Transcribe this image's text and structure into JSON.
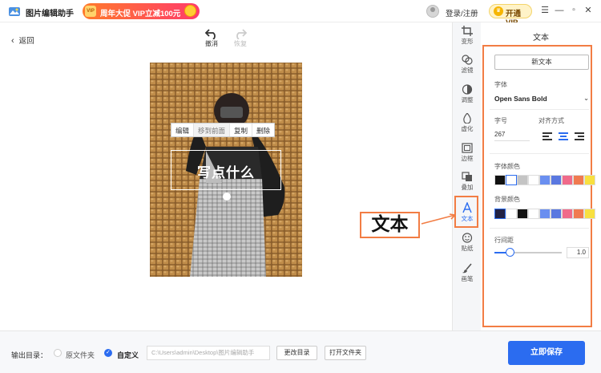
{
  "app": {
    "title": "图片编辑助手",
    "promo_badge": "VIP",
    "promo_text": "周年大促 VIP立减100元",
    "login": "登录/注册",
    "open_vip": "开通VIP",
    "window_controls": [
      "menu-icon",
      "minimize-icon",
      "restore-icon",
      "close-icon"
    ]
  },
  "toolbar": {
    "back": "返回",
    "undo": "撤消",
    "redo": "恢复"
  },
  "canvas": {
    "context_menu": [
      "编辑",
      "移到前面",
      "复制",
      "删除"
    ],
    "text_content": "写点什么"
  },
  "tools": [
    {
      "label": "变形",
      "icon": "crop-icon"
    },
    {
      "label": "滤镜",
      "icon": "filter-icon"
    },
    {
      "label": "调整",
      "icon": "adjust-icon"
    },
    {
      "label": "虚化",
      "icon": "blur-drop-icon"
    },
    {
      "label": "边框",
      "icon": "frame-icon"
    },
    {
      "label": "叠加",
      "icon": "overlay-icon"
    },
    {
      "label": "文本",
      "icon": "text-icon",
      "active": true
    },
    {
      "label": "贴纸",
      "icon": "sticker-icon"
    },
    {
      "label": "画笔",
      "icon": "brush-icon"
    }
  ],
  "panel": {
    "title": "文本",
    "new_text": "新文本",
    "font_label": "字体",
    "font_value": "Open Sans Bold",
    "size_label": "字号",
    "size_value": "267",
    "align_label": "对齐方式",
    "align_active": "center",
    "font_color_label": "字体颜色",
    "font_colors": [
      "#111111",
      "#ffffff",
      "#c4c4c4",
      "#ffffff",
      "#6a8ff0",
      "#5a78e0",
      "#f06a8a",
      "#f07a50",
      "#f8e040"
    ],
    "font_color_selected": 1,
    "bg_color_label": "背景颜色",
    "bg_colors": [
      "#222244",
      "#ffffff",
      "#111111",
      "#ffffff",
      "#6a8ff0",
      "#5a78e0",
      "#f06a8a",
      "#f07a50",
      "#f8e040"
    ],
    "bg_color_selected": 0,
    "line_spacing_label": "行间距",
    "line_spacing_value": "1.0"
  },
  "callout": {
    "text": "文本",
    "accent": "#f27d44"
  },
  "bottom": {
    "output_label": "输出目录：",
    "option_original": "原文件夹",
    "option_custom": "自定义",
    "path_placeholder": "C:\\Users\\admin\\Desktop\\图片编辑助手",
    "change_dir": "更改目录",
    "open_folder": "打开文件夹",
    "save_now": "立即保存"
  },
  "colors": {
    "primary": "#2b6cf0",
    "accent": "#f27d44"
  }
}
